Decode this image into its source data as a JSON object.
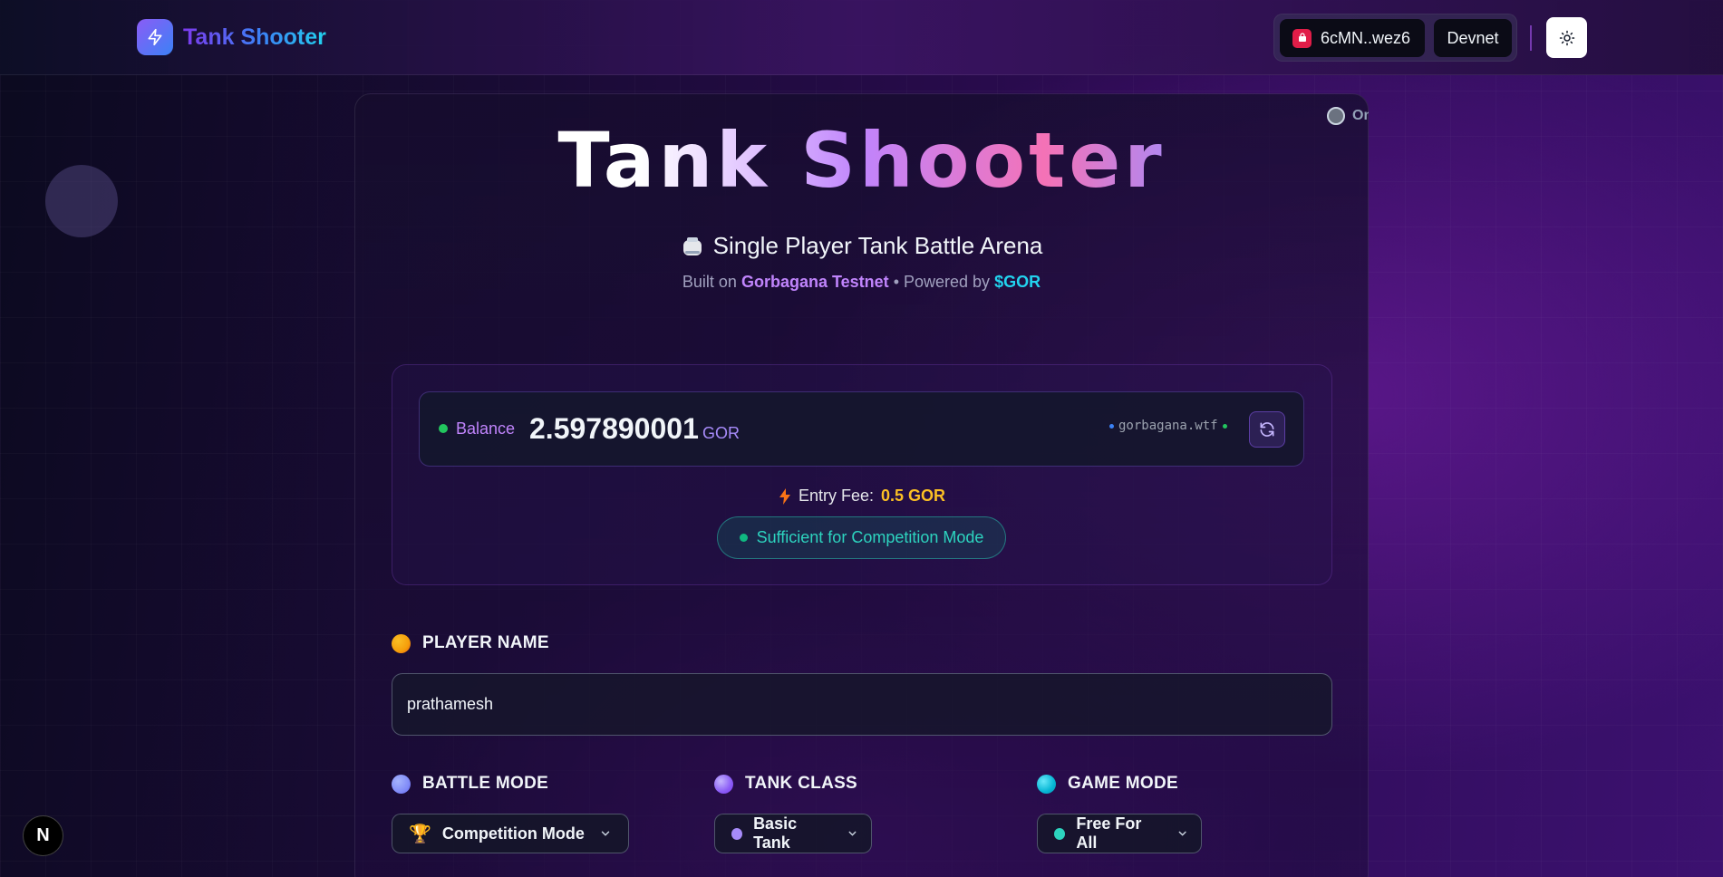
{
  "header": {
    "brand": "Tank Shooter",
    "wallet_address": "6cMN..wez6",
    "network": "Devnet"
  },
  "hero": {
    "title": "Tank Shooter",
    "subtitle": "Single Player Tank Battle Arena",
    "meta_prefix": "Built on",
    "meta_network": "Gorbagana Testnet",
    "meta_middle": "• Powered by",
    "meta_token": "$GOR"
  },
  "status": {
    "label": "Online"
  },
  "balance": {
    "label": "Balance",
    "amount": "2.597890001",
    "unit": "GOR",
    "rpc": "gorbagana.wtf"
  },
  "entry": {
    "label": "Entry Fee:",
    "fee": "0.5 GOR",
    "sufficient": "Sufficient for Competition Mode"
  },
  "form": {
    "player_name_label": "PLAYER NAME",
    "player_name_value": "prathamesh",
    "battle_mode_label": "BATTLE MODE",
    "battle_mode_value": "Competition Mode",
    "tank_class_label": "TANK CLASS",
    "tank_class_value": "Basic Tank",
    "game_mode_label": "GAME MODE",
    "game_mode_value": "Free For All"
  },
  "misc": {
    "framework_badge": "N"
  },
  "colors": {
    "accent_purple": "#8b5cf6",
    "accent_cyan": "#22d3ee",
    "success": "#22c55e",
    "fee": "#fbbf24",
    "player_dot": "#f59e0b",
    "battle_dot": "#818cf8",
    "tank_dot": "#8b5cf6",
    "game_dot": "#06b6d4"
  },
  "icons": {
    "brand": "lightning-bolt-icon",
    "wallet": "wallet-icon",
    "theme": "sun-icon",
    "tank": "tank-icon",
    "refresh": "refresh-icon",
    "fee": "lightning-icon",
    "battle_mode": "trophy-icon",
    "dropdown": "chevron-down-icon"
  }
}
